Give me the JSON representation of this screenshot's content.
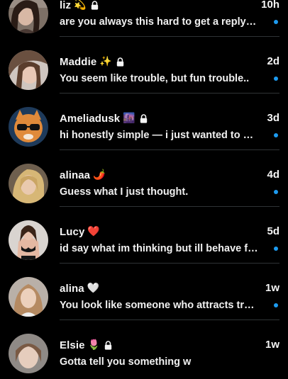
{
  "accent_color": "#1d9bf0",
  "conversations": [
    {
      "name": "liz",
      "emoji": "💫",
      "locked": true,
      "time": "10h",
      "preview": "are you always this hard to get a reply from?",
      "unread": true,
      "avatar_icon": "user-avatar"
    },
    {
      "name": "Maddie",
      "emoji": "✨",
      "locked": true,
      "time": "2d",
      "preview": "You seem like trouble, but fun trouble..",
      "unread": true,
      "avatar_icon": "user-avatar"
    },
    {
      "name": "Ameliadusk",
      "emoji": "🌆",
      "locked": true,
      "time": "3d",
      "preview": "hi honestly simple — i just wanted to say hi",
      "unread": true,
      "avatar_icon": "user-avatar"
    },
    {
      "name": "alinaa",
      "emoji": "🌶️",
      "locked": false,
      "time": "4d",
      "preview": "Guess what I just thought.",
      "unread": true,
      "avatar_icon": "user-avatar"
    },
    {
      "name": "Lucy",
      "emoji": "❤️",
      "locked": false,
      "time": "5d",
      "preview": "id say what im thinking but ill behave for now",
      "unread": true,
      "avatar_icon": "user-avatar"
    },
    {
      "name": "alina",
      "emoji": "🤍",
      "locked": false,
      "time": "1w",
      "preview": "You look like someone who attracts trouble",
      "unread": true,
      "avatar_icon": "user-avatar"
    },
    {
      "name": "Elsie",
      "emoji": "🌷",
      "locked": true,
      "time": "1w",
      "preview": "Gotta tell you something w",
      "unread": true,
      "avatar_icon": "user-avatar"
    }
  ]
}
